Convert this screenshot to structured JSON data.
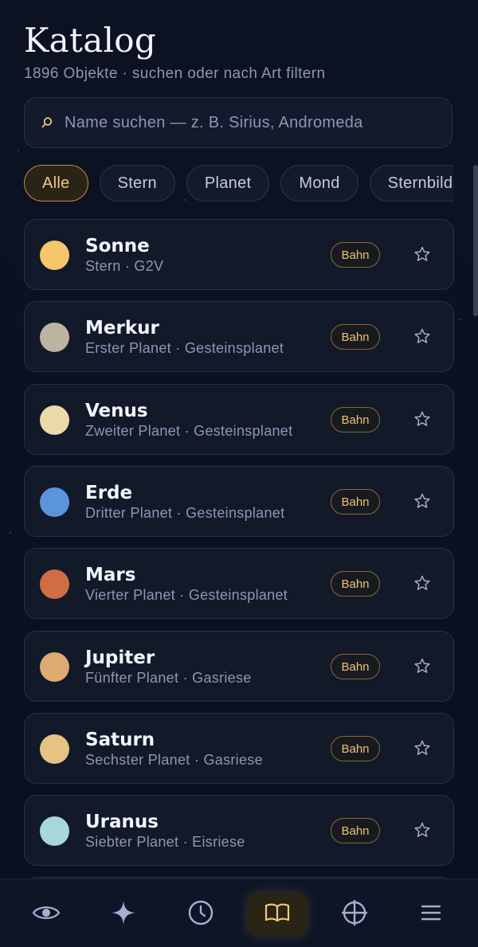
{
  "header": {
    "title": "Katalog",
    "subtitle": "1896 Objekte · suchen oder nach Art filtern"
  },
  "search": {
    "placeholder": "Name suchen — z. B. Sirius, Andromeda",
    "value": ""
  },
  "filters": [
    {
      "label": "Alle",
      "active": true
    },
    {
      "label": "Stern",
      "active": false
    },
    {
      "label": "Planet",
      "active": false
    },
    {
      "label": "Mond",
      "active": false
    },
    {
      "label": "Sternbild",
      "active": false
    }
  ],
  "objects": [
    {
      "name": "Sonne",
      "subtitle": "Stern · G2V",
      "badge": "Bahn",
      "color": "#f5c76a"
    },
    {
      "name": "Merkur",
      "subtitle": "Erster Planet · Gesteinsplanet",
      "badge": "Bahn",
      "color": "#bdb3a1"
    },
    {
      "name": "Venus",
      "subtitle": "Zweiter Planet · Gesteinsplanet",
      "badge": "Bahn",
      "color": "#ecd9a8"
    },
    {
      "name": "Erde",
      "subtitle": "Dritter Planet · Gesteinsplanet",
      "badge": "Bahn",
      "color": "#5b93dd"
    },
    {
      "name": "Mars",
      "subtitle": "Vierter Planet · Gesteinsplanet",
      "badge": "Bahn",
      "color": "#cf6d45"
    },
    {
      "name": "Jupiter",
      "subtitle": "Fünfter Planet · Gasriese",
      "badge": "Bahn",
      "color": "#dcab72"
    },
    {
      "name": "Saturn",
      "subtitle": "Sechster Planet · Gasriese",
      "badge": "Bahn",
      "color": "#e6c383"
    },
    {
      "name": "Uranus",
      "subtitle": "Siebter Planet · Eisriese",
      "badge": "Bahn",
      "color": "#a6d7dc"
    }
  ],
  "nav": [
    {
      "icon": "eye-icon",
      "active": false
    },
    {
      "icon": "sparkle-icon",
      "active": false
    },
    {
      "icon": "clock-icon",
      "active": false
    },
    {
      "icon": "book-icon",
      "active": true
    },
    {
      "icon": "crosshair-icon",
      "active": false
    },
    {
      "icon": "menu-icon",
      "active": false
    }
  ],
  "colors": {
    "accent": "#f4c878",
    "background": "#0b1120",
    "card": "#121929"
  }
}
